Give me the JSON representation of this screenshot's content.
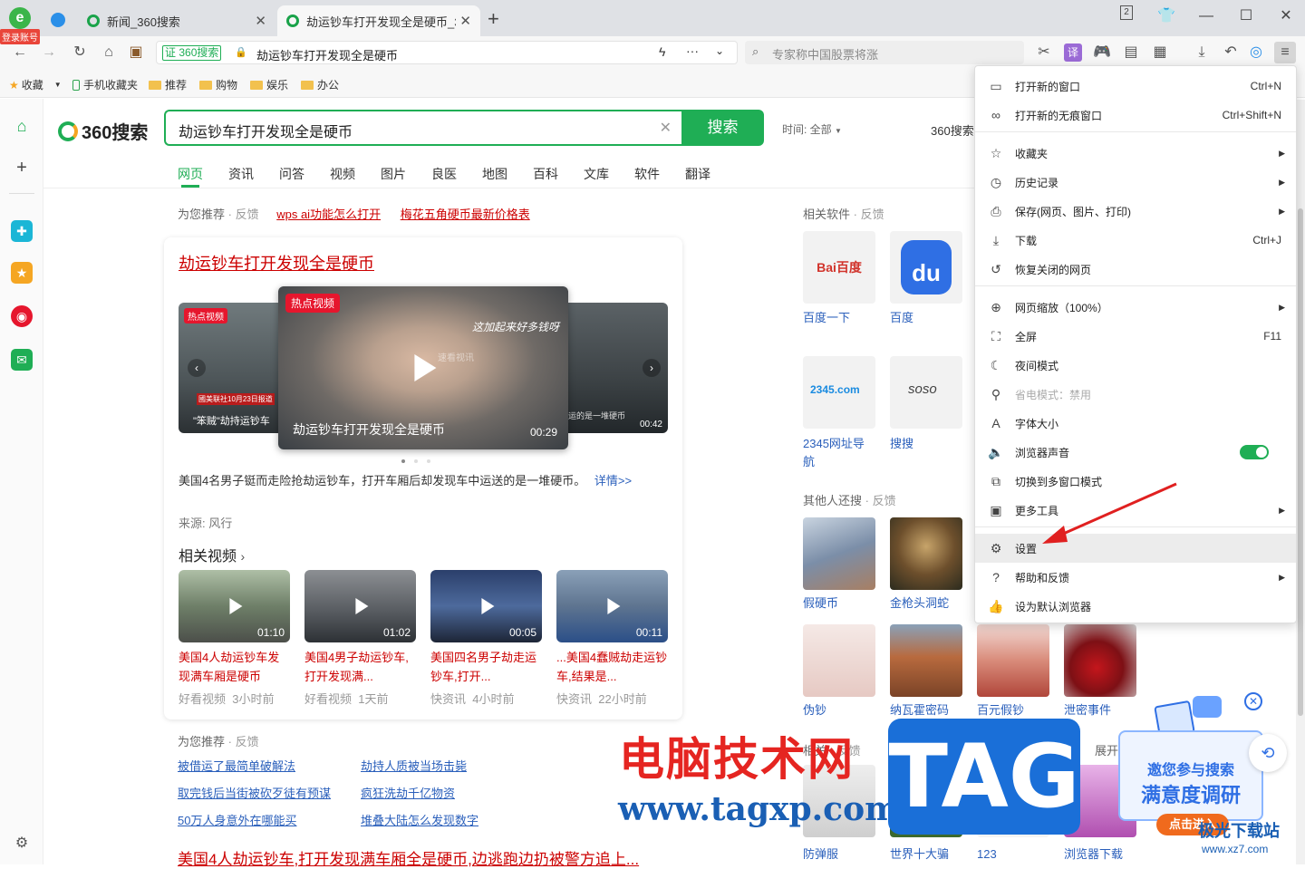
{
  "tabs": [
    {
      "label": "新闻_360搜索"
    },
    {
      "label": "劫运钞车打开发现全是硬币_3("
    }
  ],
  "account_badge": "登录账号",
  "tab_count": "2",
  "address": {
    "site_label": "360搜索",
    "url_text": "劫运钞车打开发现全是硬币",
    "search_placeholder": "专家称中国股票将涨"
  },
  "bookmarks": [
    {
      "label": "收藏"
    },
    {
      "label": "手机收藏夹"
    },
    {
      "label": "推荐"
    },
    {
      "label": "购物"
    },
    {
      "label": "娱乐"
    },
    {
      "label": "办公"
    }
  ],
  "search": {
    "logo": "360搜索",
    "query": "劫运钞车打开发现全是硬币",
    "button": "搜索",
    "time_filter": "时间: 全部",
    "right_link": "360搜索"
  },
  "nav_tabs": [
    "网页",
    "资讯",
    "问答",
    "视频",
    "图片",
    "良医",
    "地图",
    "百科",
    "文库",
    "软件",
    "翻译"
  ],
  "recommend": {
    "label": "为您推荐",
    "feedback": "· 反馈",
    "links": [
      "wps ai功能怎么打开",
      "梅花五角硬币最新价格表"
    ]
  },
  "result": {
    "title": "劫运钞车打开发现全是硬币",
    "hot_badge": "热点视频",
    "hot_badge_small": "热点视频",
    "main_video_title": "劫运钞车打开发现全是硬币",
    "main_video_duration": "00:29",
    "main_video_caption": "这加起来好多钱呀",
    "main_video_watermark": "速看视讯",
    "left_video_caption": "\"笨贼\"劫持运钞车",
    "left_video_banner": "國美联社10月23日报道",
    "right_video_duration": "00:42",
    "right_video_caption": "运的是一堆硬币",
    "summary": "美国4名男子铤而走险抢劫运钞车，打开车厢后却发现车中运送的是一堆硬币。",
    "detail_link": "详情>>",
    "source": "来源: 风行",
    "related_title": "相关视频",
    "videos": [
      {
        "duration": "01:10",
        "title": "美国4人劫运钞车发现满车厢是硬币",
        "site": "好看视频",
        "time": "3小时前"
      },
      {
        "duration": "01:02",
        "title": "美国4男子劫运钞车,打开发现满...",
        "site": "好看视频",
        "time": "1天前"
      },
      {
        "duration": "00:05",
        "title": "美国四名男子劫走运钞车,打开...",
        "site": "快资讯",
        "time": "4小时前"
      },
      {
        "duration": "00:11",
        "title": "...美国4蠢贼劫走运钞车,结果是...",
        "site": "快资讯",
        "time": "22小时前"
      }
    ]
  },
  "recommend2": {
    "label": "为您推荐",
    "feedback": "· 反馈",
    "links": [
      "被借运了最简单破解法",
      "劫持人质被当场击毙",
      "取完钱后当街被砍歹徒有预谋",
      "疯狂洗劫千亿物资",
      "50万人身意外在哪能买",
      "堆叠大陆怎么发现数字"
    ]
  },
  "bottom_result": "美国4人劫运钞车,打开发现满车厢全是硬币,边逃跑边扔被警方追上...",
  "side": {
    "software_title": "相关软件",
    "feedback": "· 反馈",
    "software": [
      {
        "label": "百度一下"
      },
      {
        "label": "百度"
      },
      {
        "label": "2345网址导航"
      },
      {
        "label": "搜搜"
      }
    ],
    "others_title": "其他人还搜",
    "others": [
      {
        "label": "假硬币"
      },
      {
        "label": "金枪头洞蛇"
      },
      {
        "label": "伪钞"
      },
      {
        "label": "纳瓦霍密码"
      },
      {
        "label": "百元假钞"
      },
      {
        "label": "泄密事件"
      }
    ],
    "related_title": "相关",
    "related_feedback": "· 反馈",
    "expand": "展开",
    "bottom": [
      {
        "label": "防弹服"
      },
      {
        "label": "世界十大骗"
      },
      {
        "label": "123"
      },
      {
        "label": "浏览器下载"
      }
    ]
  },
  "menu": {
    "items": [
      {
        "icon": "window-icon",
        "glyph": "▭",
        "label": "打开新的窗口",
        "shortcut": "Ctrl+N"
      },
      {
        "icon": "incognito-icon",
        "glyph": "∞",
        "label": "打开新的无痕窗口",
        "shortcut": "Ctrl+Shift+N"
      },
      {
        "icon": "star-list-icon",
        "glyph": "☆",
        "label": "收藏夹",
        "arrow": "▶"
      },
      {
        "icon": "history-icon",
        "glyph": "◷",
        "label": "历史记录",
        "arrow": "▶"
      },
      {
        "icon": "save-icon",
        "glyph": "⎙",
        "label": "保存(网页、图片、打印)",
        "arrow": "▶"
      },
      {
        "icon": "download-icon",
        "glyph": "⤓",
        "label": "下载",
        "shortcut": "Ctrl+J"
      },
      {
        "icon": "restore-icon",
        "glyph": "↺",
        "label": "恢复关闭的网页"
      },
      {
        "icon": "zoom-icon",
        "glyph": "⊕",
        "label": "网页缩放（100%）",
        "arrow": "▶"
      },
      {
        "icon": "fullscreen-icon",
        "glyph": "⛶",
        "label": "全屏",
        "shortcut": "F11"
      },
      {
        "icon": "moon-icon",
        "glyph": "☾",
        "label": "夜间模式"
      },
      {
        "icon": "power-save-icon",
        "glyph": "⚲",
        "label": "省电模式：禁用"
      },
      {
        "icon": "font-size-icon",
        "glyph": "A",
        "label": "字体大小"
      },
      {
        "icon": "speaker-icon",
        "glyph": "🔈",
        "label": "浏览器声音"
      },
      {
        "icon": "multi-window-icon",
        "glyph": "⧉",
        "label": "切换到多窗口模式"
      },
      {
        "icon": "toolbox-icon",
        "glyph": "▣",
        "label": "更多工具",
        "arrow": "▶"
      },
      {
        "icon": "gear-icon",
        "glyph": "⚙",
        "label": "设置"
      },
      {
        "icon": "help-icon",
        "glyph": "?",
        "label": "帮助和反馈",
        "arrow": "▶"
      },
      {
        "icon": "thumbs-up-icon",
        "glyph": "👍",
        "label": "设为默认浏览器"
      }
    ]
  },
  "survey": {
    "line1": "邀您参与搜索",
    "line2": "满意度调研",
    "button": "点击进入"
  },
  "watermark": {
    "cn": "电脑技术网",
    "url": "www.tagxp.com",
    "tag": "TAG",
    "site2": "极光下载站",
    "site2_url": "www.xz7.com"
  },
  "colors": {
    "accent_green": "#1fae55",
    "link_red": "#cc0000",
    "link_blue": "#2a5fbb"
  }
}
